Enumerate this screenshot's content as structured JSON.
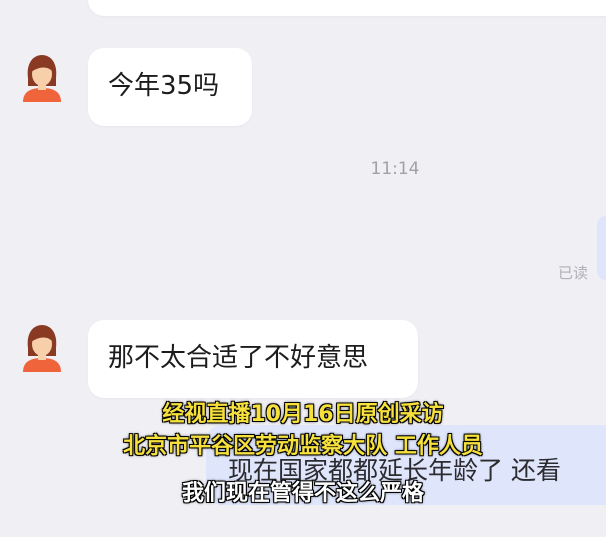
{
  "chat": {
    "messages": [
      {
        "sender": "other",
        "text": "今年35吗"
      },
      {
        "sender": "other",
        "text": "那不太合适了不好意思"
      }
    ],
    "timestamp": "11:14",
    "read_receipt": "已读",
    "outgoing_partial": "现在国家都都延长年龄了 还看"
  },
  "subtitles": {
    "line1": "经视直播10月16日原创采访",
    "line2": "北京市平谷区劳动监察大队 工作人员",
    "line3": "我们现在管得不这么严格"
  },
  "colors": {
    "background": "#efeff4",
    "incoming_bubble": "#ffffff",
    "outgoing_bubble": "#dfe5fb",
    "subtitle_yellow": "#f6e03c",
    "subtitle_white": "#ffffff"
  }
}
